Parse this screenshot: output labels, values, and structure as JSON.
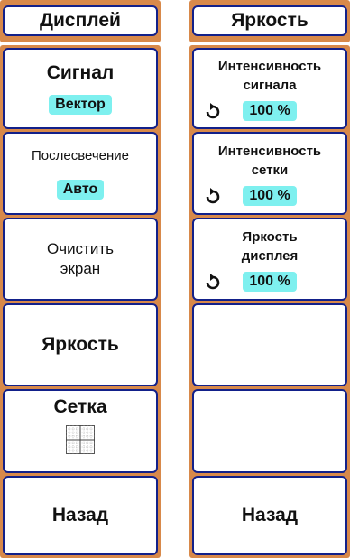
{
  "left_panel": {
    "title": "Дисплей",
    "buttons": {
      "signal": {
        "label": "Сигнал",
        "value": "Вектор"
      },
      "persistence": {
        "label": "Послесвечение",
        "value": "Авто"
      },
      "clear": {
        "line1": "Очистить",
        "line2": "экран"
      },
      "brightness": {
        "label": "Яркость"
      },
      "grid": {
        "label": "Сетка",
        "icon": "grid-icon"
      },
      "back": {
        "label": "Назад"
      }
    }
  },
  "right_panel": {
    "title": "Яркость",
    "buttons": {
      "signal_intensity": {
        "line1": "Интенсивность",
        "line2": "сигнала",
        "value": "100 %",
        "icon": "rotary-knob-icon"
      },
      "grid_intensity": {
        "line1": "Интенсивность",
        "line2": "сетки",
        "value": "100 %",
        "icon": "rotary-knob-icon"
      },
      "display_brightness": {
        "line1": "Яркость",
        "line2": "дисплея",
        "value": "100 %",
        "icon": "rotary-knob-icon"
      },
      "back": {
        "label": "Назад"
      }
    }
  },
  "colors": {
    "panel_frame": "#d8894a",
    "button_border": "#12208a",
    "value_badge": "#7ef0ef"
  }
}
